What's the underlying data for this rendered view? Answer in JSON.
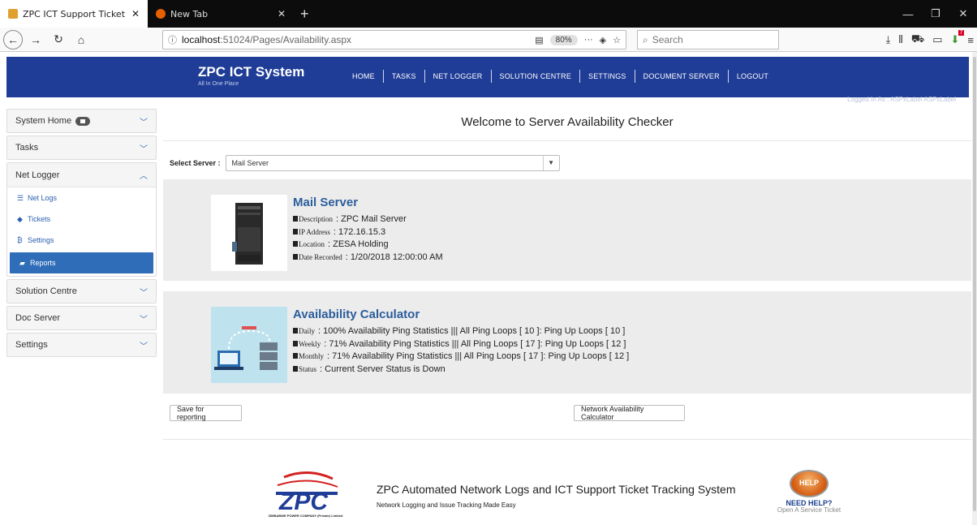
{
  "browser": {
    "tabs": [
      {
        "title": "ZPC ICT Support Ticket System",
        "close": "✕"
      },
      {
        "title": "New Tab",
        "close": "✕"
      }
    ],
    "new_tab": "+",
    "url_host": "localhost",
    "url_path": ":51024/Pages/Availability.aspx",
    "zoom": "80%",
    "search_placeholder": "Search",
    "download_badge": "7"
  },
  "header": {
    "brand_name": "ZPC ICT System",
    "brand_tagline": "All In One Place",
    "menu": [
      "HOME",
      "TASKS",
      "NET LOGGER",
      "SOLUTION CENTRE",
      "SETTINGS",
      "DOCUMENT SERVER",
      "LOGOUT"
    ],
    "logged_in": "Logged In As : ASPxLabel ASPxLabel"
  },
  "sidebar": {
    "system_home": "System Home",
    "tasks": "Tasks",
    "net_logger": "Net Logger",
    "net_logger_items": [
      "Net Logs",
      "Tickets",
      "Settings",
      "Reports"
    ],
    "solution_centre": "Solution Centre",
    "doc_server": "Doc Server",
    "settings": "Settings"
  },
  "main": {
    "welcome": "Welcome to Server Availability Checker",
    "select_label": "Select Server :",
    "select_value": "Mail Server",
    "server": {
      "title": "Mail Server",
      "description_label": "Description",
      "description": ": ZPC Mail Server",
      "ip_label": "IP Address",
      "ip": ": 172.16.15.3",
      "location_label": "Location",
      "location": ": ZESA Holding",
      "date_label": "Date Recorded",
      "date": ": 1/20/2018 12:00:00 AM"
    },
    "calc": {
      "title": "Availability Calculator",
      "daily_label": "Daily",
      "daily": ": 100% Availability Ping Statistics ||| All Ping Loops [ 10 ]: Ping Up Loops [ 10 ]",
      "weekly_label": "Weekly",
      "weekly": ": 71% Availability Ping Statistics ||| All Ping Loops [ 17 ]: Ping Up Loops [ 12 ]",
      "monthly_label": "Monthly",
      "monthly": ": 71% Availability Ping Statistics ||| All Ping Loops [ 17 ]: Ping Up Loops [ 12 ]",
      "status_label": "Status",
      "status": ": Current Server Status is Down"
    },
    "save_button": "Save for reporting",
    "network_button": "Network Availability Calculator"
  },
  "footer": {
    "title": "ZPC Automated Network Logs and ICT Support Ticket Tracking System",
    "subtitle": "Network Logging and Issue Tracking Made Easy",
    "logo_text": "ZIMBABWE POWER COMPANY (Private) Limited",
    "help_ball": "HELP",
    "help_need": "NEED HELP?",
    "help_open": "Open A Service Ticket"
  },
  "colors": {
    "header_blue": "#1f3c96",
    "link_blue": "#2b5fb0",
    "active_item": "#2f6db8",
    "panel_gray": "#ececec"
  }
}
